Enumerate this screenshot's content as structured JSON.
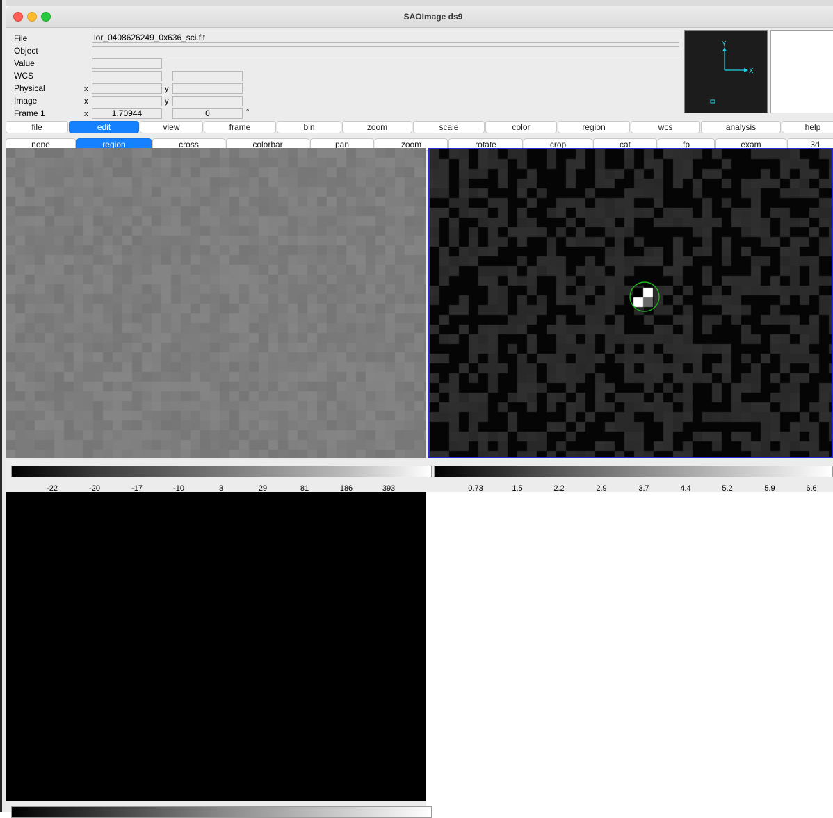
{
  "window": {
    "title": "SAOImage ds9"
  },
  "info": {
    "labels": {
      "file": "File",
      "object": "Object",
      "value": "Value",
      "wcs": "WCS",
      "physical": "Physical",
      "image": "Image",
      "frame": "Frame 1"
    },
    "axis_x": "x",
    "axis_y": "y",
    "file_value": "lor_0408626249_0x636_sci.fit",
    "object_value": "",
    "value_value": "",
    "frame_zoom": "1.70944",
    "frame_angle": "0",
    "degree_symbol": "°"
  },
  "panner": {
    "axis_y": "Y",
    "axis_x": "X"
  },
  "menu_bar": [
    {
      "label": "file",
      "active": false
    },
    {
      "label": "edit",
      "active": true
    },
    {
      "label": "view",
      "active": false
    },
    {
      "label": "frame",
      "active": false
    },
    {
      "label": "bin",
      "active": false
    },
    {
      "label": "zoom",
      "active": false
    },
    {
      "label": "scale",
      "active": false
    },
    {
      "label": "color",
      "active": false
    },
    {
      "label": "region",
      "active": false
    },
    {
      "label": "wcs",
      "active": false
    },
    {
      "label": "analysis",
      "active": false
    },
    {
      "label": "help",
      "active": false
    }
  ],
  "mode_bar": [
    {
      "label": "none",
      "active": false
    },
    {
      "label": "region",
      "active": true
    },
    {
      "label": "cross",
      "active": false
    },
    {
      "label": "colorbar",
      "active": false
    },
    {
      "label": "pan",
      "active": false
    },
    {
      "label": "zoom",
      "active": false
    },
    {
      "label": "rotate",
      "active": false
    },
    {
      "label": "crop",
      "active": false
    },
    {
      "label": "cat",
      "active": false
    },
    {
      "label": "fp",
      "active": false
    },
    {
      "label": "exam",
      "active": false
    },
    {
      "label": "3d",
      "active": false
    }
  ],
  "colorbar1": {
    "ticks": [
      "-22",
      "-20",
      "-17",
      "-10",
      "3",
      "29",
      "81",
      "186",
      "393"
    ]
  },
  "colorbar2": {
    "ticks": [
      "0.73",
      "1.5",
      "2.2",
      "2.9",
      "3.7",
      "4.4",
      "5.2",
      "5.9",
      "6.6"
    ]
  },
  "colors": {
    "accent": "#1681fe",
    "frame_highlight": "#2a2ad4",
    "region_circle": "#1fb31f",
    "panner_compass": "#22d3e6"
  }
}
